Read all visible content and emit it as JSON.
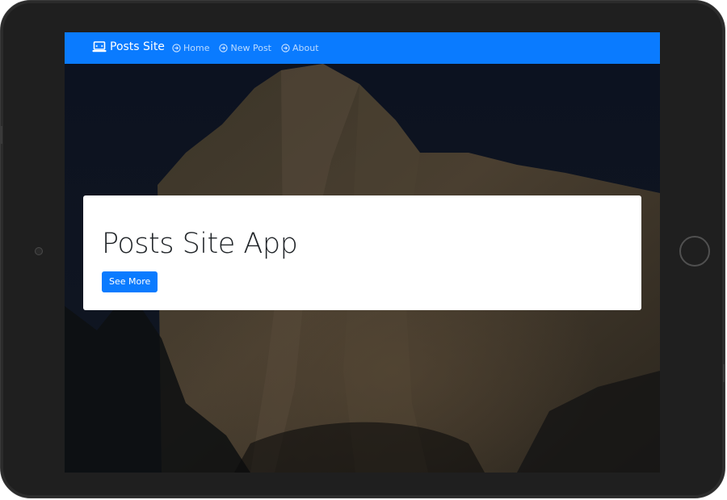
{
  "navbar": {
    "brand_label": "Posts Site",
    "brand_icon": "laptop-icon",
    "links": [
      {
        "label": "Home",
        "icon": "arrow-circle-right-icon"
      },
      {
        "label": "New Post",
        "icon": "arrow-circle-right-icon"
      },
      {
        "label": "About",
        "icon": "arrow-circle-right-icon"
      }
    ]
  },
  "hero": {
    "background": "mountain-cliff-photo",
    "title": "Posts Site App",
    "button_label": "See More"
  },
  "colors": {
    "primary": "#0a7bff",
    "device_frame": "#1f1f1f",
    "screen_background": "#0e141f",
    "card_background": "#ffffff",
    "title_text": "#212529"
  }
}
